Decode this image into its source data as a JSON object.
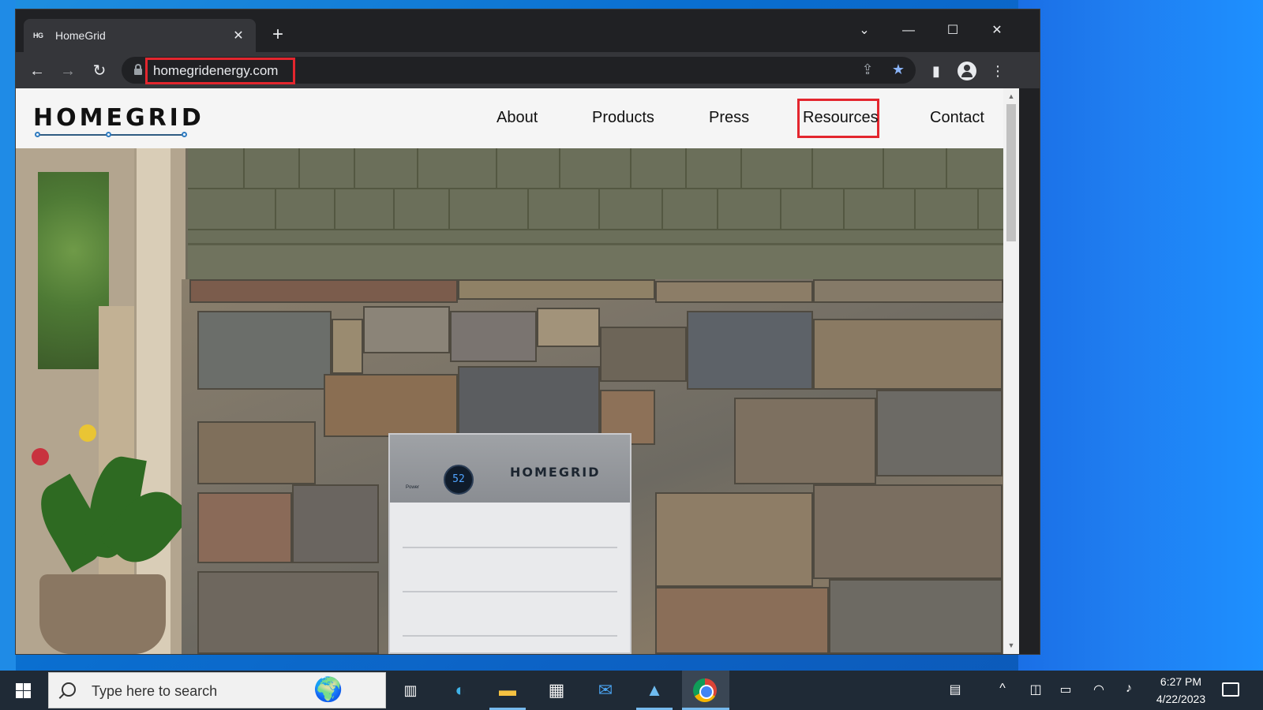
{
  "browser": {
    "tab_favicon": "HG",
    "tab_title": "HomeGrid",
    "tab_close": "✕",
    "new_tab": "+",
    "window_controls": [
      "⌄",
      "—",
      "☐",
      "✕"
    ],
    "url": "homegridenergy.com"
  },
  "site": {
    "logo_text": "HOMEGRID",
    "nav": [
      {
        "label": "About"
      },
      {
        "label": "Products"
      },
      {
        "label": "Press"
      },
      {
        "label": "Resources"
      },
      {
        "label": "Contact"
      }
    ],
    "battery_display": "52",
    "battery_brand": "HOMEGRID",
    "battery_power_label": "Power"
  },
  "taskbar": {
    "search_placeholder": "Type here to search",
    "time": "6:27 PM",
    "date": "4/22/2023"
  },
  "colors": {
    "highlight": "#e3262e",
    "browser_dark": "#202124",
    "toolbar": "#35363a",
    "star": "#8ab4f8"
  }
}
